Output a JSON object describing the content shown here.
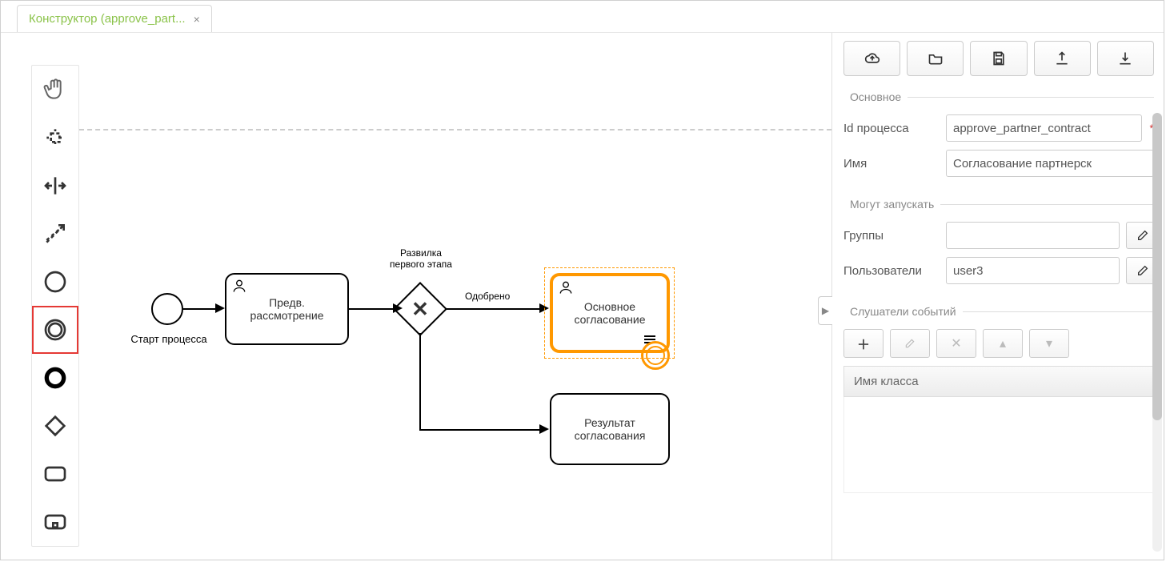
{
  "tab": {
    "title": "Конструктор (approve_part...",
    "close": "×"
  },
  "nodes": {
    "start_label": "Старт процесса",
    "task1": "Предв.\nрассмотрение",
    "gateway_label": "Развилка\nпервого этапа",
    "edge_approved": "Одобрено",
    "task2": "Основное\nсогласование",
    "task3": "Результат\nсогласования"
  },
  "panel": {
    "section_main": "Основное",
    "id_label": "Id процесса",
    "id_value": "approve_partner_contract",
    "name_label": "Имя",
    "name_value": "Согласование партнерск",
    "section_start": "Могут запускать",
    "groups_label": "Группы",
    "groups_value": "",
    "users_label": "Пользователи",
    "users_value": "user3",
    "section_listeners": "Слушатели событий",
    "class_header": "Имя класса"
  }
}
